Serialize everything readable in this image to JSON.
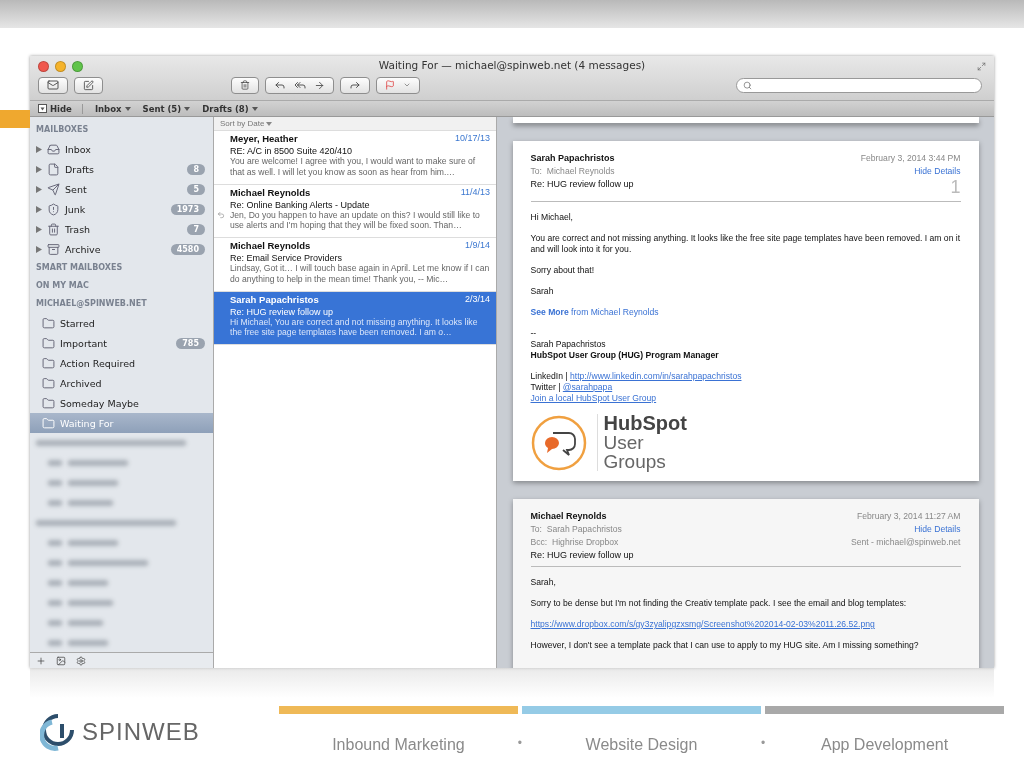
{
  "window": {
    "title": "Waiting For — michael@spinweb.net (4 messages)"
  },
  "favorites_bar": [
    {
      "kind": "hide",
      "label": "Hide"
    },
    {
      "kind": "menu",
      "label": "Inbox"
    },
    {
      "kind": "menu",
      "label": "Sent (5)"
    },
    {
      "kind": "menu",
      "label": "Drafts (8)"
    }
  ],
  "sidebar": {
    "sections": [
      {
        "title": "MAILBOXES",
        "items": [
          {
            "kind": "inbox",
            "label": "Inbox",
            "selected": false
          },
          {
            "kind": "drafts",
            "label": "Drafts",
            "count": "8",
            "selected": false
          },
          {
            "kind": "sent",
            "label": "Sent",
            "count": "5",
            "selected": false
          },
          {
            "kind": "junk",
            "label": "Junk",
            "count": "1973",
            "selected": false
          },
          {
            "kind": "trash",
            "label": "Trash",
            "count": "7",
            "selected": false
          },
          {
            "kind": "archive",
            "label": "Archive",
            "count": "4580",
            "selected": false
          }
        ]
      },
      {
        "title": "SMART MAILBOXES"
      },
      {
        "title": "ON MY MAC"
      },
      {
        "title": "MICHAEL@SPINWEB.NET",
        "items": [
          {
            "kind": "folder",
            "label": "Starred",
            "selected": false
          },
          {
            "kind": "folder",
            "label": "Important",
            "count": "785",
            "selected": false
          },
          {
            "kind": "folder",
            "label": "Action Required",
            "selected": false
          },
          {
            "kind": "folder",
            "label": "Archived",
            "selected": false
          },
          {
            "kind": "folder",
            "label": "Someday Maybe",
            "selected": false
          },
          {
            "kind": "folder",
            "label": "Waiting For",
            "selected": true
          }
        ]
      }
    ]
  },
  "message_list": {
    "sort_label": "Sort by Date",
    "messages": [
      {
        "sender": "Meyer, Heather",
        "date": "10/17/13",
        "subject": "RE: A/C in 8500 Suite 420/410",
        "preview": "You are welcome! I agree with you, I would want to make sure of that as well. I will let you know as soon as hear from him.…",
        "replied": false,
        "selected": false
      },
      {
        "sender": "Michael Reynolds",
        "date": "11/4/13",
        "subject": "Re: Online Banking Alerts - Update",
        "preview": "Jen, Do you happen to have an update on this? I would still like to use alerts and I'm hoping that they will be fixed soon. Than…",
        "replied": true,
        "selected": false
      },
      {
        "sender": "Michael Reynolds",
        "date": "1/9/14",
        "subject": "Re: Email Service Providers",
        "preview": "Lindsay, Got it… I will touch base again in April. Let me know if I can do anything to help in the mean time! Thank you, -- Mic…",
        "replied": false,
        "selected": false
      },
      {
        "sender": "Sarah Papachristos",
        "date": "2/3/14",
        "subject": "Re: HUG review follow up",
        "preview": "Hi Michael, You are correct and not missing anything. It looks like the free site page templates have been removed. I am o…",
        "replied": false,
        "selected": true
      }
    ]
  },
  "emails": [
    {
      "from": "Sarah Papachristos",
      "date": "February 3, 2014  3:44 PM",
      "hide_details": "Hide Details",
      "number": "1",
      "headers": [
        {
          "label": "To:",
          "value": "Michael Reynolds"
        }
      ],
      "subject": "Re: HUG review follow up",
      "body": [
        {
          "kind": "text",
          "text": "Hi Michael,"
        },
        {
          "kind": "text",
          "text": "You are correct and not missing anything. It looks like the free site page templates have been removed. I am on it and will look into it for you."
        },
        {
          "kind": "text",
          "text": "Sorry about that!"
        },
        {
          "kind": "text",
          "text": "Sarah"
        },
        {
          "kind": "see_more",
          "text": "**See More** from Michael Reynolds"
        },
        {
          "kind": "signature",
          "lines": [
            {
              "kind": "plain",
              "text": "--"
            },
            {
              "kind": "plain",
              "text": "Sarah Papachristos"
            },
            {
              "kind": "bold",
              "text": "HubSpot User Group (HUG) Program Manager"
            }
          ]
        },
        {
          "kind": "signature",
          "lines": [
            {
              "kind": "link",
              "label": "LinkedIn | ",
              "text": "http://www.linkedin.com/in/sarahpapachristos"
            },
            {
              "kind": "link",
              "label": "Twitter | ",
              "text": "@sarahpapa"
            },
            {
              "kind": "link",
              "text": "Join a local HubSpot User Group"
            }
          ]
        },
        {
          "kind": "logo",
          "lines": [
            "HubSpot",
            "User",
            "Groups"
          ]
        }
      ]
    },
    {
      "from": "Michael Reynolds",
      "date": "February 3, 2014  11:27 AM",
      "hide_details": "Hide Details",
      "account": "Sent - michael@spinweb.net",
      "headers": [
        {
          "label": "To:",
          "value": "Sarah Papachristos"
        },
        {
          "label": "Bcc:",
          "value": "Highrise Dropbox"
        }
      ],
      "subject": "Re: HUG review follow up",
      "body": [
        {
          "kind": "text",
          "text": "Sarah,"
        },
        {
          "kind": "text",
          "text": "Sorry to be dense but I'm not finding the Creativ template pack. I see the email and blog templates:"
        },
        {
          "kind": "url",
          "text": "https://www.dropbox.com/s/gy3zyalipgzxsmg/Screenshot%202014-02-03%2011.26.52.png"
        },
        {
          "kind": "text",
          "text": "However, I don't see a template pack that I can use to apply to my HUG site. Am I missing something?"
        }
      ]
    }
  ],
  "footer": {
    "brand": "SPINWEB",
    "services": [
      {
        "label": "Inbound Marketing",
        "color": "#efb957"
      },
      {
        "label": "Website Design",
        "color": "#95cbe6"
      },
      {
        "label": "App Development",
        "color": "#a9a9a9"
      }
    ],
    "separators": [
      "•",
      "•"
    ]
  }
}
